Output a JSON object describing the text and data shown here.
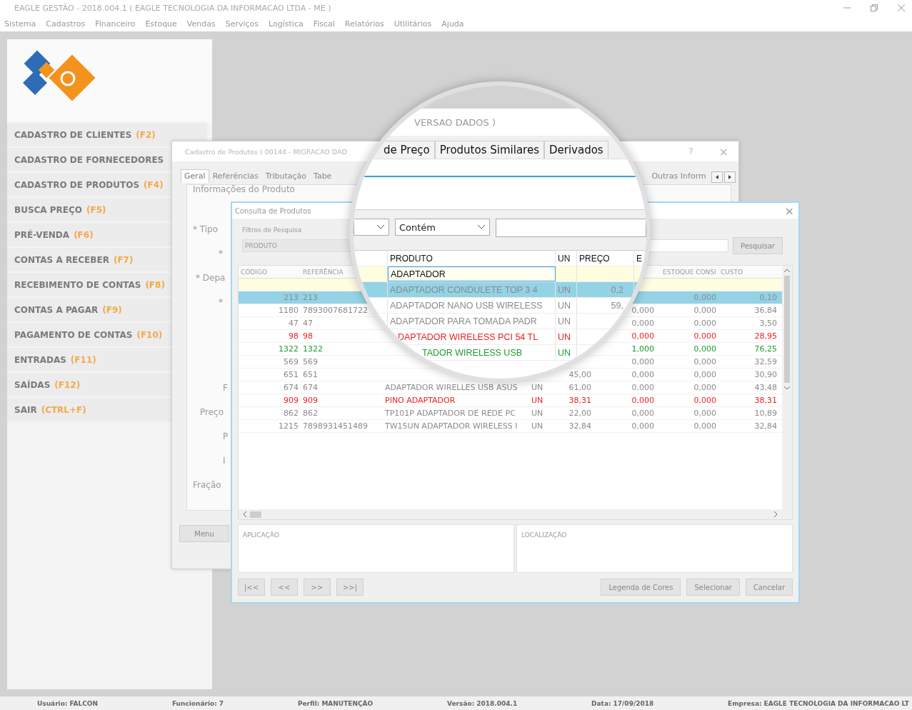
{
  "window": {
    "title": "EAGLE GESTÃO - 2018.004.1 ( EAGLE TECNOLOGIA DA INFORMACAO LTDA - ME )"
  },
  "menu": [
    "Sistema",
    "Cadastros",
    "Financeiro",
    "Estoque",
    "Vendas",
    "Serviços",
    "Logística",
    "Fiscal",
    "Relatórios",
    "Utilitários",
    "Ajuda"
  ],
  "sidebar": {
    "items": [
      {
        "label": "CADASTRO DE CLIENTES",
        "shortcut": "(F2)"
      },
      {
        "label": "CADASTRO DE FORNECEDORES"
      },
      {
        "label": "CADASTRO DE PRODUTOS",
        "shortcut": "(F4)"
      },
      {
        "label": "BUSCA PREÇO",
        "shortcut": "(F5)"
      },
      {
        "label": "PRÉ-VENDA",
        "shortcut": "(F6)"
      },
      {
        "label": "CONTAS A RECEBER",
        "shortcut": "(F7)"
      },
      {
        "label": "RECEBIMENTO DE CONTAS",
        "shortcut": "(F8)"
      },
      {
        "label": "CONTAS A PAGAR",
        "shortcut": "(F9)"
      },
      {
        "label": "PAGAMENTO DE CONTAS",
        "shortcut": "(F10)"
      },
      {
        "label": "ENTRADAS",
        "shortcut": "(F11)"
      },
      {
        "label": "SAÍDAS",
        "shortcut": "(F12)"
      },
      {
        "label": "SAIR",
        "shortcut": "(CTRL+F)"
      }
    ]
  },
  "product_window": {
    "title": "Cadastro de Produtos ( 00144 - MIGRACAO DAD",
    "help": "?",
    "close": "×",
    "tabs": [
      {
        "label": "Geral",
        "selected": true
      },
      {
        "label": "Referências",
        "selected": false
      },
      {
        "label": "Tributação",
        "selected": false
      },
      {
        "label": "Tabe",
        "selected": false
      },
      {
        "label": "Outras Inform",
        "selected": false
      }
    ],
    "group_title": "Informações do Produto",
    "form_labels": [
      "* Tipo",
      "*",
      "* Depa",
      "*",
      "F",
      "Preço",
      "P",
      "I",
      "Fração"
    ],
    "menu_button": "Menu"
  },
  "search_window": {
    "title": "Consulta de Produtos",
    "close": "×",
    "filter_label": "Filtros de Pesquisa",
    "filter_value": "PRODUTO",
    "search_button": "Pesquisar",
    "columns": {
      "codigo": "CÓDIGO",
      "referencia": "REFERÊNCIA",
      "estoque_consi": "ESTOQUE CONSI",
      "custo": "CUSTO"
    },
    "rows": [
      {
        "selected": true,
        "color": "#8a8a8a",
        "cells": {
          "codigo": "213",
          "referencia": "213",
          "estoque_consi": "0,000",
          "custo": "0,10"
        }
      },
      {
        "selected": false,
        "color": "#8a8a8a",
        "cells": {
          "codigo": "1180",
          "referencia": "7893007681722",
          "column_6": "0,000",
          "estoque_consi": "0,000",
          "custo": "36,84"
        }
      },
      {
        "selected": false,
        "color": "#8a8a8a",
        "cells": {
          "codigo": "47",
          "referencia": "47",
          "column_6": "0,000",
          "estoque_consi": "0,000",
          "custo": "3,50"
        }
      },
      {
        "selected": false,
        "color": "#e52222",
        "cells": {
          "codigo": "98",
          "referencia": "98",
          "column_6": "0,000",
          "estoque_consi": "0,000",
          "custo": "28,95"
        }
      },
      {
        "selected": false,
        "color": "#1e9a2e",
        "cells": {
          "codigo": "1322",
          "referencia": "1322",
          "column_6": "1,000",
          "estoque_consi": "0,000",
          "custo": "76,25"
        }
      },
      {
        "selected": false,
        "color": "#8a8a8a",
        "cells": {
          "codigo": "569",
          "referencia": "569",
          "column_6": "0,000",
          "estoque_consi": "0,000",
          "custo": "32,59"
        }
      },
      {
        "selected": false,
        "color": "#8a8a8a",
        "cells": {
          "codigo": "651",
          "referencia": "651",
          "column_5": "45,00",
          "column_6": "0,000",
          "estoque_consi": "0,000",
          "custo": "30,90"
        }
      },
      {
        "selected": false,
        "color": "#8a8a8a",
        "cells": {
          "codigo": "674",
          "referencia": "674",
          "column_3": "ADAPTADOR WIRELLES USB ASUS",
          "column_4": "UN",
          "column_5": "61,00",
          "column_6": "0,000",
          "estoque_consi": "0,000",
          "custo": "43,48"
        }
      },
      {
        "selected": false,
        "color": "#e52222",
        "cells": {
          "codigo": "909",
          "referencia": "909",
          "column_3": "PINO ADAPTADOR",
          "column_4": "UN",
          "column_5": "38,31",
          "column_6": "0,000",
          "estoque_consi": "0,000",
          "custo": "38,31"
        }
      },
      {
        "selected": false,
        "color": "#8a8a8a",
        "cells": {
          "codigo": "862",
          "referencia": "862",
          "column_3": "TP101P ADAPTADOR DE REDE PC",
          "column_4": "UN",
          "column_5": "22,00",
          "column_6": "0,000",
          "estoque_consi": "0,000",
          "custo": "10,89"
        }
      },
      {
        "selected": false,
        "color": "#8a8a8a",
        "cells": {
          "codigo": "1215",
          "referencia": "7898931451489",
          "column_3": "TW15UN ADAPTADOR WIRELESS I",
          "column_4": "UN",
          "column_5": "32,84",
          "column_6": "0,000",
          "estoque_consi": "0,000",
          "custo": "32,84"
        }
      }
    ],
    "panels": [
      "APLICAÇÃO",
      "LOCALIZAÇÃO"
    ],
    "nav_buttons": [
      "|<<",
      "<<",
      ">>",
      ">>|"
    ],
    "action_buttons": [
      "Legenda de Cores",
      "Selecionar",
      "Cancelar"
    ]
  },
  "magnifier": {
    "title": "VERSAO DADOS )",
    "tabs": [
      "de Preço",
      "Produtos Similares",
      "Derivados"
    ],
    "match_mode": "Contém",
    "columns": [
      "PRODUTO",
      "UN",
      "PREÇO",
      "E"
    ],
    "filter_value": "ADAPTADOR",
    "rows": [
      {
        "produto": "ADAPTADOR CONDULETE TOP 3 4",
        "un": "UN",
        "preco": "0,2",
        "selected": true,
        "color": "#8a8a8a"
      },
      {
        "produto": "ADAPTADOR NANO USB WIRELESS",
        "un": "UN",
        "preco": "59,",
        "selected": false,
        "color": "#8a8a8a"
      },
      {
        "produto": "ADAPTADOR PARA TOMADA PADR",
        "un": "UN",
        "selected": false,
        "color": "#8a8a8a"
      },
      {
        "produto": "DAPTADOR WIRELESS PCI 54 TL",
        "un": "UN",
        "selected": false,
        "color": "#e52222"
      },
      {
        "produto": "TADOR WIRELESS USB",
        "un": "UN",
        "selected": false,
        "color": "#1e9a2e"
      }
    ]
  },
  "status_bar": [
    {
      "label": "Usuário:",
      "value": "FALCON"
    },
    {
      "label": "Funcionário:",
      "value": "7"
    },
    {
      "label": "Perfil:",
      "value": "MANUTENÇÃO"
    },
    {
      "label": "Versão:",
      "value": "2018.004.1"
    },
    {
      "label": "Data:",
      "value": "17/09/2018"
    },
    {
      "label": "Empresa:",
      "value": "EAGLE TECNOLOGIA DA INFORMACAO LT"
    }
  ]
}
